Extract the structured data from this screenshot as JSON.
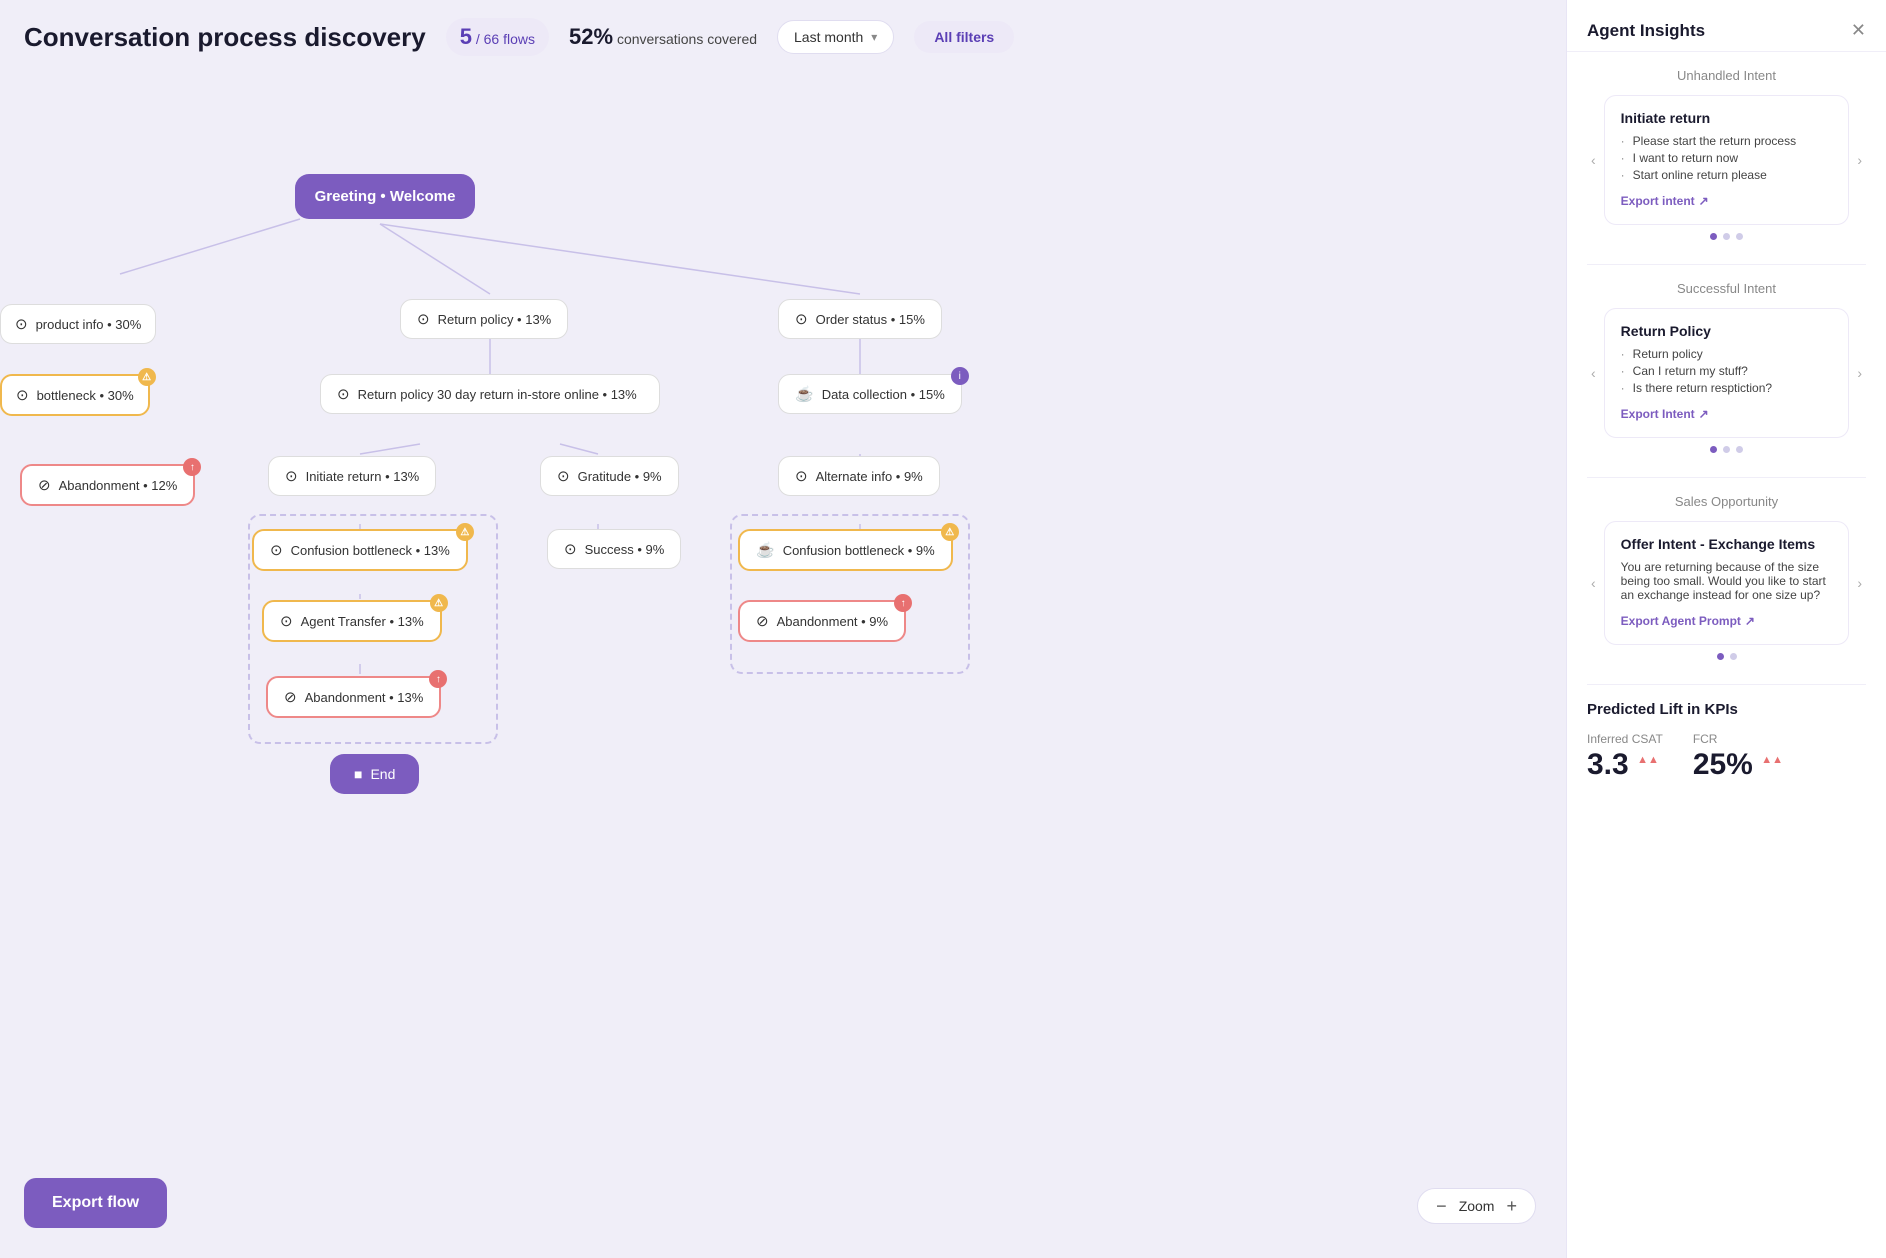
{
  "header": {
    "title": "Conversation process discovery",
    "flows_num": "5",
    "flows_total": "66 flows",
    "coverage_pct": "52%",
    "coverage_label": "conversations covered",
    "date_filter": "Last month",
    "all_filters_label": "All filters"
  },
  "flow_nodes": {
    "greeting": "Greeting • Welcome",
    "return_policy": "Return policy • 13%",
    "return_policy_30": "Return policy 30 day return in-store online • 13%",
    "order_status": "Order status • 15%",
    "data_collection": "Data collection • 15%",
    "initiate_return": "Initiate return • 13%",
    "gratitude": "Gratitude • 9%",
    "alternate_info": "Alternate info • 9%",
    "confusion_bottleneck_left": "Confusion bottleneck • 13%",
    "success": "Success • 9%",
    "confusion_bottleneck_right": "Confusion bottleneck • 9%",
    "agent_transfer": "Agent Transfer • 13%",
    "abandonment_left_top": "Abandonment • 12%",
    "abandonment_left_bottom": "Abandonment • 13%",
    "abandonment_right": "Abandonment • 9%",
    "product_info": "product info • 30%",
    "bottleneck": "bottleneck • 30%",
    "end": "End"
  },
  "export_flow": "Export flow",
  "zoom": {
    "label": "Zoom",
    "minus": "−",
    "plus": "+"
  },
  "panel": {
    "title": "Agent Insights",
    "sections": [
      {
        "label": "Unhandled Intent",
        "card_title": "Initiate return",
        "bullets": [
          "Please start the return process",
          "I want to return now",
          "Start online return please"
        ],
        "export_label": "Export intent",
        "dots": [
          true,
          false,
          false
        ]
      },
      {
        "label": "Successful Intent",
        "card_title": "Return Policy",
        "bullets": [
          "Return policy",
          "Can I return my stuff?",
          "Is there return resptiction?"
        ],
        "export_label": "Export Intent",
        "dots": [
          true,
          false,
          false
        ]
      },
      {
        "label": "Sales Opportunity",
        "card_title": "Offer Intent - Exchange Items",
        "body": "You are returning because of the size being too small. Would you like to start an exchange instead for one size up?",
        "export_label": "Export Agent Prompt",
        "dots": [
          true,
          false
        ]
      }
    ],
    "kpi": {
      "title": "Predicted Lift in KPIs",
      "csat_label": "Inferred CSAT",
      "csat_value": "3.3",
      "csat_change": "▲▲",
      "fcr_label": "FCR",
      "fcr_value": "25%",
      "fcr_change": "▲▲"
    }
  }
}
